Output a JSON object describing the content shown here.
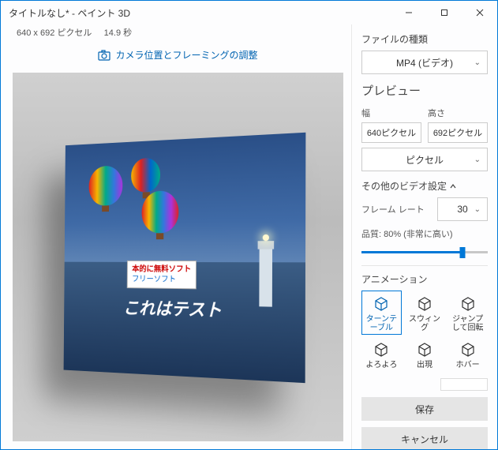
{
  "window": {
    "title": "タイトルなし* - ペイント 3D"
  },
  "meta": {
    "dimensions": "640 x 692 ピクセル",
    "duration": "14.9 秒"
  },
  "camera_button": "カメラ位置とフレーミングの調整",
  "overlay": {
    "line1": "本的に無料ソフト",
    "line2": "フリーソフト",
    "test": "これはテスト"
  },
  "panel": {
    "file_type_label": "ファイルの種類",
    "file_type_value": "MP4 (ビデオ)",
    "preview_label": "プレビュー",
    "width_label": "幅",
    "height_label": "高さ",
    "width_value": "640ピクセル",
    "height_value": "692ピクセル",
    "unit_value": "ピクセル",
    "other_settings": "その他のビデオ設定",
    "framerate_label": "フレーム レート",
    "framerate_value": "30",
    "quality_label": "品質: 80% (非常に高い)",
    "quality_percent": 80,
    "animation_label": "アニメーション",
    "animations": [
      "ターンテーブル",
      "スウィング",
      "ジャンプして回転",
      "よろよろ",
      "出現",
      "ホバー"
    ],
    "save_label": "保存",
    "cancel_label": "キャンセル"
  }
}
